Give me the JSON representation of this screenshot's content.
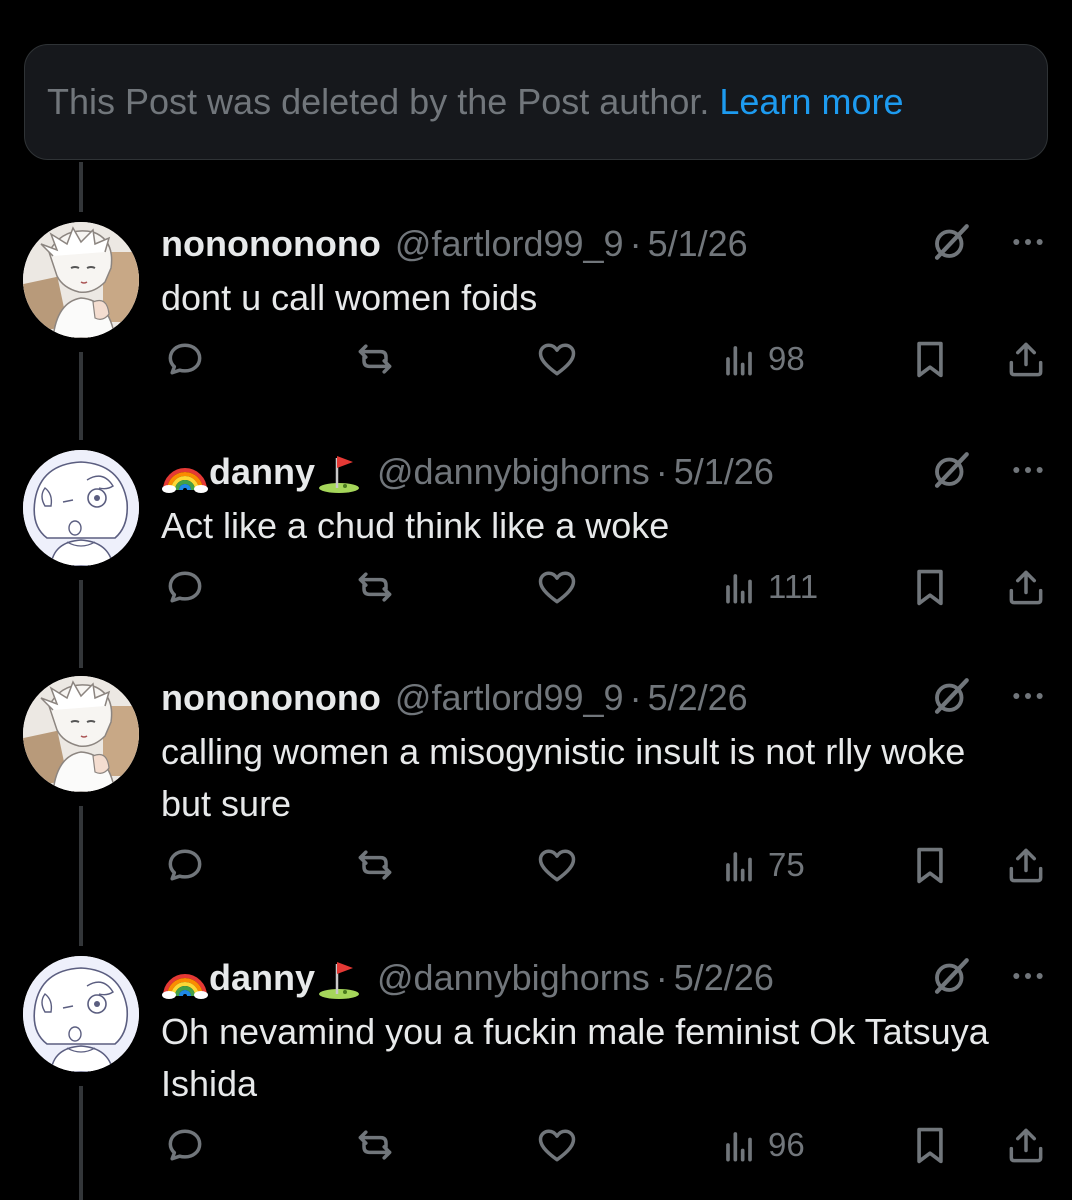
{
  "deleted_notice": {
    "text": "This Post was deleted by the Post author.",
    "link": "Learn more"
  },
  "posts": [
    {
      "display_name": "nonononono",
      "handle": "@fartlord99_9",
      "separator": "·",
      "date": "5/1/26",
      "text": "dont u call women foids",
      "views": "98",
      "avatar": "anime-boy-avatar"
    },
    {
      "display_name": "danny",
      "emoji_before": "rainbow-emoji",
      "emoji_after": "golf-flag-emoji",
      "handle": "@dannybighorns",
      "separator": "·",
      "date": "5/1/26",
      "text": "Act like a chud think like a woke",
      "views": "111",
      "avatar": "sketch-character-avatar"
    },
    {
      "display_name": "nonononono",
      "handle": "@fartlord99_9",
      "separator": "·",
      "date": "5/2/26",
      "text": "calling women a misogynistic insult is not rlly woke but sure",
      "views": "75",
      "avatar": "anime-boy-avatar"
    },
    {
      "display_name": "danny",
      "emoji_before": "rainbow-emoji",
      "emoji_after": "golf-flag-emoji",
      "handle": "@dannybighorns",
      "separator": "·",
      "date": "5/2/26",
      "text": "Oh nevamind you a fuckin male feminist Ok Tatsuya Ishida",
      "views": "96",
      "avatar": "sketch-character-avatar"
    }
  ],
  "icons": {
    "reply": "reply-icon",
    "repost": "repost-icon",
    "like": "heart-icon",
    "views": "views-icon",
    "bookmark": "bookmark-icon",
    "share": "share-icon",
    "grok": "grok-icon",
    "more": "more-icon"
  },
  "colors": {
    "background": "#000000",
    "text": "#e7e9ea",
    "muted": "#71767b",
    "link": "#1d9bf0",
    "notice_bg": "#16181c",
    "thread_line": "#333639"
  }
}
